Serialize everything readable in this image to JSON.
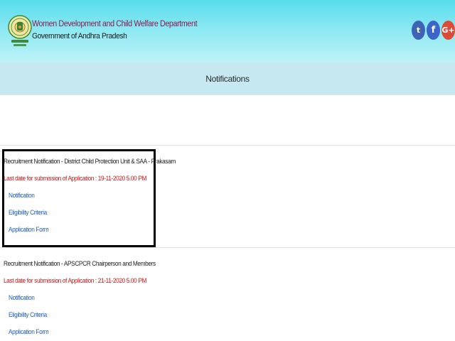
{
  "header": {
    "department": "Women Development and Child Welfare Department",
    "government": "Government of Andhra Pradesh",
    "emblem_icon": "ap-state-emblem-icon",
    "social": [
      {
        "name": "twitter-icon",
        "glyph": "t",
        "color": "#3f63b5"
      },
      {
        "name": "facebook-icon",
        "glyph": "f",
        "color": "#3d64c9"
      },
      {
        "name": "google-plus-icon",
        "glyph": "G+",
        "color": "#dc4a38"
      }
    ]
  },
  "nav": {
    "title": "Notifications"
  },
  "notifications": [
    {
      "title": "Recruitment Notification - District Child Protection Unit & SAA - Prakasam",
      "deadline": "Last date for submission of Application : 19-11-2020 5.00 PM",
      "links": [
        "Notification",
        "Eligibility Criteria",
        "Application Form"
      ]
    },
    {
      "title": "Recruitment Notification - APSCPCR Chairperson and Members",
      "deadline": "Last date for submission of Application : 21-11-2020 5.00 PM",
      "links": [
        "Notification",
        "Eligibility Criteria",
        "Application Form"
      ]
    }
  ],
  "colors": {
    "header_top": "#56ddec",
    "nav_bar": "#c6e9f1",
    "department_text": "#8e1b4e",
    "deadline_text": "#d01414",
    "link_text": "#1f5fc2"
  }
}
